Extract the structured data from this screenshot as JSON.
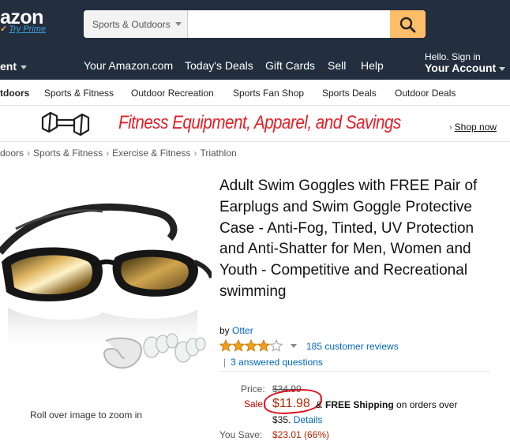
{
  "header": {
    "logo_text": "azon",
    "try_prime": "Try Prime",
    "search": {
      "department": "Sports & Outdoors",
      "placeholder": "",
      "button_icon": "search-icon"
    },
    "nav": {
      "departments": "ent",
      "links": [
        "Your Amazon.com",
        "Today's Deals",
        "Gift Cards",
        "Sell",
        "Help"
      ],
      "account_hello": "Hello. Sign in",
      "account_label": "Your Account"
    },
    "colors": {
      "bar": "#232f3e",
      "search_button": "#febd69"
    }
  },
  "subnav": {
    "category": "tdoors",
    "items": [
      "Sports & Fitness",
      "Outdoor Recreation",
      "Sports Fan Shop",
      "Sports Deals",
      "Outdoor Deals"
    ]
  },
  "banner": {
    "icon": "dumbbell-icon",
    "text": "Fitness Equipment, Apparel, and Savings",
    "shop_now": "Shop now"
  },
  "breadcrumb": [
    "doors",
    "Sports & Fitness",
    "Exercise & Fitness",
    "Triathlon"
  ],
  "product": {
    "zoom_hint": "Roll over image to zoom in",
    "title": "Adult Swim Goggles with FREE Pair of Earplugs and Swim Goggle Protective Case - Anti-Fog, Tinted, UV Protection and Anti-Shatter for Men, Women and Youth - Competitive and Recreational swimming",
    "by_label": "by",
    "brand": "Otter",
    "rating_stars": 4.0,
    "reviews": "185 customer reviews",
    "answered": "3 answered questions",
    "price_label": "Price:",
    "list_price": "$34.99",
    "sale_label": "Sale:",
    "sale_price": "$11.98",
    "amp": "&",
    "free_shipping": "FREE Shipping",
    "shipping_rest": "on orders over",
    "shipping_min": "$35.",
    "details": "Details",
    "you_save_label": "You Save:",
    "you_save": "$23.01 (66%)"
  }
}
